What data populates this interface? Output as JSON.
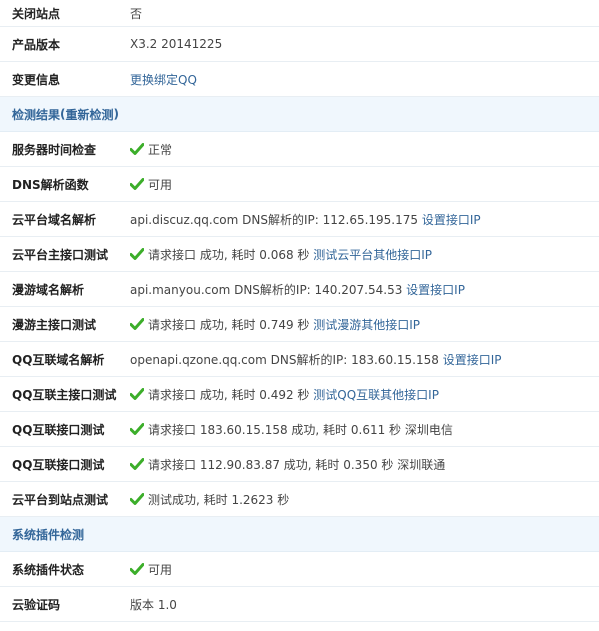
{
  "rows_top": [
    {
      "label": "关闭站点",
      "value": "否"
    },
    {
      "label": "产品版本",
      "value": "X3.2 20141225"
    },
    {
      "label": "变更信息",
      "link": "更换绑定QQ"
    }
  ],
  "section1": {
    "title": "检测结果",
    "recheck_link": "重新检测",
    "lparen": "(",
    "rparen": ")"
  },
  "check_rows": [
    {
      "label": "服务器时间检查",
      "ok": true,
      "text": "正常"
    },
    {
      "label": "DNS解析函数",
      "ok": true,
      "text": "可用"
    },
    {
      "label": "云平台域名解析",
      "text": "api.discuz.qq.com DNS解析的IP: 112.65.195.175",
      "link": "设置接口IP"
    },
    {
      "label": "云平台主接口测试",
      "ok": true,
      "text": "请求接口 成功, 耗时 0.068 秒",
      "link": "测试云平台其他接口IP"
    },
    {
      "label": "漫游域名解析",
      "text": "api.manyou.com DNS解析的IP: 140.207.54.53",
      "link": "设置接口IP"
    },
    {
      "label": "漫游主接口测试",
      "ok": true,
      "text": "请求接口 成功, 耗时 0.749 秒",
      "link": "测试漫游其他接口IP"
    },
    {
      "label": "QQ互联域名解析",
      "text": "openapi.qzone.qq.com DNS解析的IP: 183.60.15.158",
      "link": "设置接口IP"
    },
    {
      "label": "QQ互联主接口测试",
      "ok": true,
      "text": "请求接口 成功, 耗时 0.492 秒",
      "link": "测试QQ互联其他接口IP"
    },
    {
      "label": "QQ互联接口测试",
      "ok": true,
      "text": "请求接口 183.60.15.158 成功, 耗时 0.611 秒 深圳电信"
    },
    {
      "label": "QQ互联接口测试",
      "ok": true,
      "text": "请求接口 112.90.83.87 成功, 耗时 0.350 秒 深圳联通"
    },
    {
      "label": "云平台到站点测试",
      "ok": true,
      "text": "测试成功, 耗时 1.2623 秒"
    }
  ],
  "section2": {
    "title": "系统插件检测"
  },
  "plugin_rows": [
    {
      "label": "系统插件状态",
      "ok": true,
      "text": "可用"
    },
    {
      "label": "云验证码",
      "text": "版本 1.0"
    }
  ],
  "colors": {
    "link": "#336699",
    "check": "#3cae2a",
    "section_bg": "#f0f7fd"
  },
  "icons": {
    "check": "check-icon"
  }
}
